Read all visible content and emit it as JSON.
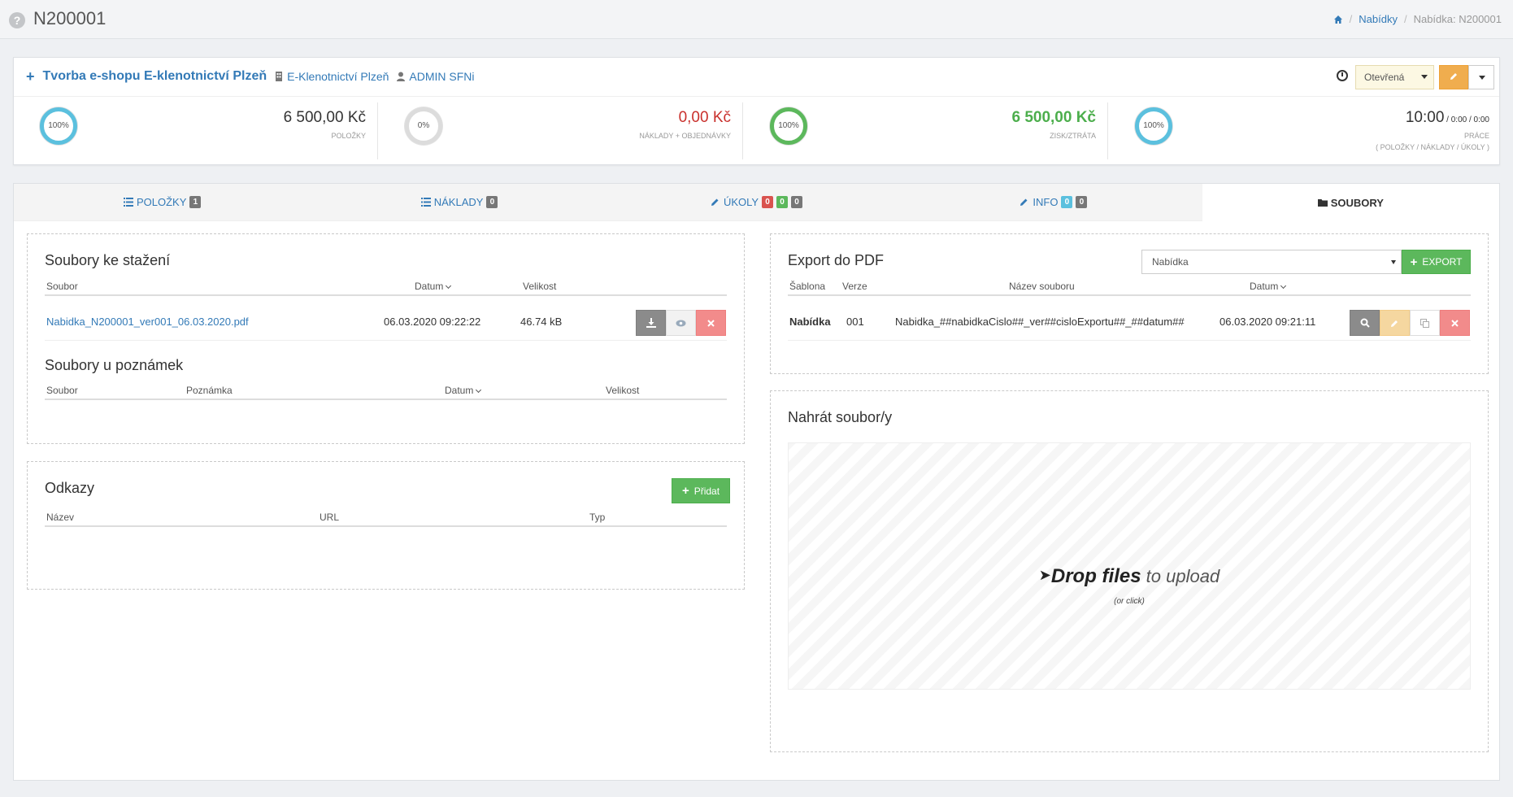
{
  "header": {
    "title": "N200001",
    "breadcrumb": {
      "home_icon": "home-icon",
      "items": [
        "Nabídky"
      ],
      "current": "Nabídka: N200001"
    }
  },
  "summary": {
    "project_title": "Tvorba e-shopu E-klenotnictví Plzeň",
    "company": "E-Klenotnictví Plzeň",
    "user": "ADMIN SFNi",
    "status": "Otevřená",
    "stats": [
      {
        "percent": "100",
        "value": "6 500,00 Kč",
        "label": "POLOŽKY",
        "color": "#5bc0de"
      },
      {
        "percent": "0",
        "value": "0,00 Kč",
        "label": "NÁKLADY + OBJEDNÁVKY",
        "color": "#c9302c"
      },
      {
        "percent": "100",
        "value": "6 500,00 Kč",
        "label": "ZISK/ZTRÁTA",
        "color": "#5cb85c"
      },
      {
        "percent": "100",
        "value_main": "10:00",
        "value_rest": " / 0:00 / 0:00",
        "label": "PRÁCE",
        "sublabel": "( POLOŽKY / NÁKLADY / ÚKOLY )",
        "color": "#5bc0de"
      }
    ]
  },
  "tabs": [
    {
      "label": "POLOŽKY",
      "icon": "list-icon",
      "badges": [
        "1"
      ]
    },
    {
      "label": "NÁKLADY",
      "icon": "list-icon",
      "badges": [
        "0"
      ]
    },
    {
      "label": "ÚKOLY",
      "icon": "pencil-icon",
      "badges": [
        "0",
        "0",
        "0"
      ]
    },
    {
      "label": "INFO",
      "icon": "pencil-icon",
      "badges": [
        "0",
        "0"
      ]
    },
    {
      "label": "SOUBORY",
      "icon": "folder-icon",
      "badges": [],
      "active": true
    }
  ],
  "downloads": {
    "title": "Soubory ke stažení",
    "columns": [
      "Soubor",
      "Datum",
      "Velikost"
    ],
    "rows": [
      {
        "file": "Nabidka_N200001_ver001_06.03.2020.pdf",
        "date": "06.03.2020 09:22:22",
        "size": "46.74 kB"
      }
    ]
  },
  "notes_files": {
    "title": "Soubory u poznámek",
    "columns": [
      "Soubor",
      "Poznámka",
      "Datum",
      "Velikost"
    ]
  },
  "links": {
    "title": "Odkazy",
    "add_label": "Přidat",
    "columns": [
      "Název",
      "URL",
      "Typ"
    ]
  },
  "export": {
    "title": "Export do PDF",
    "template_selected": "Nabídka",
    "export_label": "EXPORT",
    "columns": [
      "Šablona",
      "Verze",
      "Název souboru",
      "Datum"
    ],
    "rows": [
      {
        "template": "Nabídka",
        "version": "001",
        "filename": "Nabidka_##nabidkaCislo##_ver##cisloExportu##_##datum##",
        "date": "06.03.2020 09:21:11"
      }
    ]
  },
  "upload": {
    "title": "Nahrát soubor/y",
    "drop_bold": "Drop files",
    "drop_rest": " to upload",
    "drop_sub": "(or click)"
  }
}
